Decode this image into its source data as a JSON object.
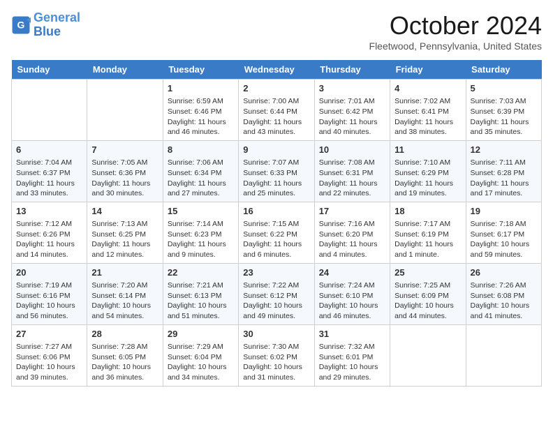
{
  "logo": {
    "line1": "General",
    "line2": "Blue"
  },
  "title": "October 2024",
  "location": "Fleetwood, Pennsylvania, United States",
  "days_of_week": [
    "Sunday",
    "Monday",
    "Tuesday",
    "Wednesday",
    "Thursday",
    "Friday",
    "Saturday"
  ],
  "weeks": [
    [
      {
        "day": "",
        "info": ""
      },
      {
        "day": "",
        "info": ""
      },
      {
        "day": "1",
        "info": "Sunrise: 6:59 AM\nSunset: 6:46 PM\nDaylight: 11 hours and 46 minutes."
      },
      {
        "day": "2",
        "info": "Sunrise: 7:00 AM\nSunset: 6:44 PM\nDaylight: 11 hours and 43 minutes."
      },
      {
        "day": "3",
        "info": "Sunrise: 7:01 AM\nSunset: 6:42 PM\nDaylight: 11 hours and 40 minutes."
      },
      {
        "day": "4",
        "info": "Sunrise: 7:02 AM\nSunset: 6:41 PM\nDaylight: 11 hours and 38 minutes."
      },
      {
        "day": "5",
        "info": "Sunrise: 7:03 AM\nSunset: 6:39 PM\nDaylight: 11 hours and 35 minutes."
      }
    ],
    [
      {
        "day": "6",
        "info": "Sunrise: 7:04 AM\nSunset: 6:37 PM\nDaylight: 11 hours and 33 minutes."
      },
      {
        "day": "7",
        "info": "Sunrise: 7:05 AM\nSunset: 6:36 PM\nDaylight: 11 hours and 30 minutes."
      },
      {
        "day": "8",
        "info": "Sunrise: 7:06 AM\nSunset: 6:34 PM\nDaylight: 11 hours and 27 minutes."
      },
      {
        "day": "9",
        "info": "Sunrise: 7:07 AM\nSunset: 6:33 PM\nDaylight: 11 hours and 25 minutes."
      },
      {
        "day": "10",
        "info": "Sunrise: 7:08 AM\nSunset: 6:31 PM\nDaylight: 11 hours and 22 minutes."
      },
      {
        "day": "11",
        "info": "Sunrise: 7:10 AM\nSunset: 6:29 PM\nDaylight: 11 hours and 19 minutes."
      },
      {
        "day": "12",
        "info": "Sunrise: 7:11 AM\nSunset: 6:28 PM\nDaylight: 11 hours and 17 minutes."
      }
    ],
    [
      {
        "day": "13",
        "info": "Sunrise: 7:12 AM\nSunset: 6:26 PM\nDaylight: 11 hours and 14 minutes."
      },
      {
        "day": "14",
        "info": "Sunrise: 7:13 AM\nSunset: 6:25 PM\nDaylight: 11 hours and 12 minutes."
      },
      {
        "day": "15",
        "info": "Sunrise: 7:14 AM\nSunset: 6:23 PM\nDaylight: 11 hours and 9 minutes."
      },
      {
        "day": "16",
        "info": "Sunrise: 7:15 AM\nSunset: 6:22 PM\nDaylight: 11 hours and 6 minutes."
      },
      {
        "day": "17",
        "info": "Sunrise: 7:16 AM\nSunset: 6:20 PM\nDaylight: 11 hours and 4 minutes."
      },
      {
        "day": "18",
        "info": "Sunrise: 7:17 AM\nSunset: 6:19 PM\nDaylight: 11 hours and 1 minute."
      },
      {
        "day": "19",
        "info": "Sunrise: 7:18 AM\nSunset: 6:17 PM\nDaylight: 10 hours and 59 minutes."
      }
    ],
    [
      {
        "day": "20",
        "info": "Sunrise: 7:19 AM\nSunset: 6:16 PM\nDaylight: 10 hours and 56 minutes."
      },
      {
        "day": "21",
        "info": "Sunrise: 7:20 AM\nSunset: 6:14 PM\nDaylight: 10 hours and 54 minutes."
      },
      {
        "day": "22",
        "info": "Sunrise: 7:21 AM\nSunset: 6:13 PM\nDaylight: 10 hours and 51 minutes."
      },
      {
        "day": "23",
        "info": "Sunrise: 7:22 AM\nSunset: 6:12 PM\nDaylight: 10 hours and 49 minutes."
      },
      {
        "day": "24",
        "info": "Sunrise: 7:24 AM\nSunset: 6:10 PM\nDaylight: 10 hours and 46 minutes."
      },
      {
        "day": "25",
        "info": "Sunrise: 7:25 AM\nSunset: 6:09 PM\nDaylight: 10 hours and 44 minutes."
      },
      {
        "day": "26",
        "info": "Sunrise: 7:26 AM\nSunset: 6:08 PM\nDaylight: 10 hours and 41 minutes."
      }
    ],
    [
      {
        "day": "27",
        "info": "Sunrise: 7:27 AM\nSunset: 6:06 PM\nDaylight: 10 hours and 39 minutes."
      },
      {
        "day": "28",
        "info": "Sunrise: 7:28 AM\nSunset: 6:05 PM\nDaylight: 10 hours and 36 minutes."
      },
      {
        "day": "29",
        "info": "Sunrise: 7:29 AM\nSunset: 6:04 PM\nDaylight: 10 hours and 34 minutes."
      },
      {
        "day": "30",
        "info": "Sunrise: 7:30 AM\nSunset: 6:02 PM\nDaylight: 10 hours and 31 minutes."
      },
      {
        "day": "31",
        "info": "Sunrise: 7:32 AM\nSunset: 6:01 PM\nDaylight: 10 hours and 29 minutes."
      },
      {
        "day": "",
        "info": ""
      },
      {
        "day": "",
        "info": ""
      }
    ]
  ]
}
